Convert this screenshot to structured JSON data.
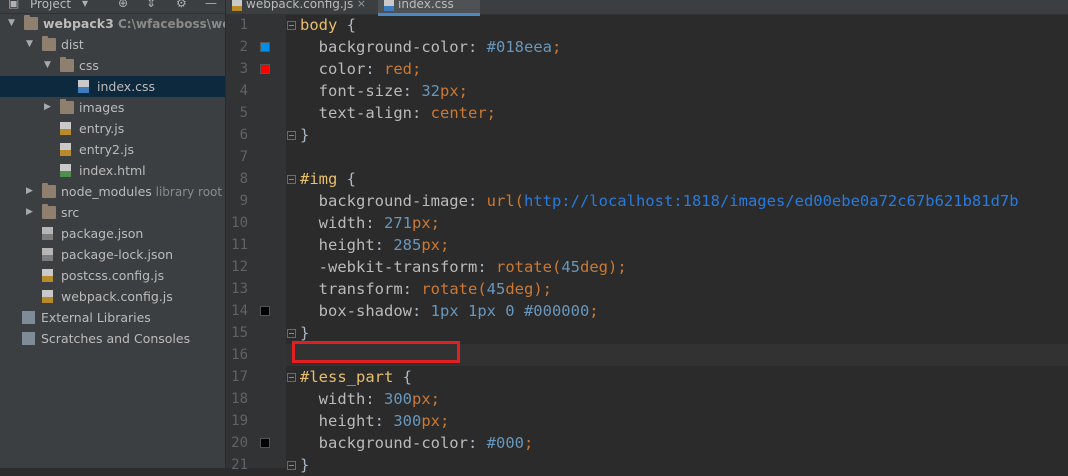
{
  "project": {
    "header_label": "Project",
    "icons": [
      "chevron-down-icon",
      "add-icon",
      "collapse-icon",
      "gear-icon",
      "minimize-icon"
    ],
    "tree": [
      {
        "label": "webpack3",
        "hint": "C:\\wfaceboss\\webpa",
        "icon": "folder-icon",
        "expanded": true,
        "depth": 0
      },
      {
        "label": "dist",
        "icon": "folder-icon",
        "expanded": true,
        "depth": 1
      },
      {
        "label": "css",
        "icon": "folder-icon",
        "expanded": true,
        "depth": 2
      },
      {
        "label": "index.css",
        "icon": "css-file-icon",
        "depth": 3,
        "selected": true
      },
      {
        "label": "images",
        "icon": "folder-icon",
        "expanded": false,
        "depth": 2
      },
      {
        "label": "entry.js",
        "icon": "js-file-icon",
        "depth": 2
      },
      {
        "label": "entry2.js",
        "icon": "js-file-icon",
        "depth": 2
      },
      {
        "label": "index.html",
        "icon": "html-file-icon",
        "depth": 2
      },
      {
        "label": "node_modules",
        "hint": "library root",
        "icon": "folder-icon",
        "expanded": false,
        "depth": 1
      },
      {
        "label": "src",
        "icon": "folder-icon",
        "expanded": false,
        "depth": 1
      },
      {
        "label": "package.json",
        "icon": "json-file-icon",
        "depth": 1
      },
      {
        "label": "package-lock.json",
        "icon": "json-file-icon",
        "depth": 1
      },
      {
        "label": "postcss.config.js",
        "icon": "js-file-icon",
        "depth": 1
      },
      {
        "label": "webpack.config.js",
        "icon": "js-file-icon",
        "depth": 1
      },
      {
        "label": "External Libraries",
        "icon": "library-icon",
        "depth": 0
      },
      {
        "label": "Scratches and Consoles",
        "icon": "scratches-icon",
        "depth": 0
      }
    ]
  },
  "editor": {
    "tabs": [
      {
        "label": "webpack.config.js",
        "icon": "js-file-icon",
        "active": false
      },
      {
        "label": "index.css",
        "icon": "css-file-icon",
        "active": true
      }
    ],
    "line_numbers": [
      "1",
      "2",
      "3",
      "4",
      "5",
      "6",
      "7",
      "8",
      "9",
      "10",
      "11",
      "12",
      "13",
      "14",
      "15",
      "16",
      "17",
      "18",
      "19",
      "20",
      "21"
    ],
    "lines": [
      [
        {
          "t": "body",
          "c": "sel"
        },
        {
          "t": " {",
          "c": "plain"
        }
      ],
      [
        {
          "t": "  background-color",
          "c": "prop"
        },
        {
          "t": ": ",
          "c": "plain"
        },
        {
          "t": "#018eea",
          "c": "num"
        },
        {
          "t": ";",
          "c": "kw"
        }
      ],
      [
        {
          "t": "  color",
          "c": "prop"
        },
        {
          "t": ": ",
          "c": "plain"
        },
        {
          "t": "red",
          "c": "kw"
        },
        {
          "t": ";",
          "c": "kw"
        }
      ],
      [
        {
          "t": "  font-size",
          "c": "prop"
        },
        {
          "t": ": ",
          "c": "plain"
        },
        {
          "t": "32",
          "c": "num"
        },
        {
          "t": "px",
          "c": "kw"
        },
        {
          "t": ";",
          "c": "kw"
        }
      ],
      [
        {
          "t": "  text-align",
          "c": "prop"
        },
        {
          "t": ": ",
          "c": "plain"
        },
        {
          "t": "center",
          "c": "kw"
        },
        {
          "t": ";",
          "c": "kw"
        }
      ],
      [
        {
          "t": "}",
          "c": "plain"
        }
      ],
      [],
      [
        {
          "t": "#img",
          "c": "sel"
        },
        {
          "t": " {",
          "c": "plain"
        }
      ],
      [
        {
          "t": "  background-image",
          "c": "prop"
        },
        {
          "t": ": ",
          "c": "plain"
        },
        {
          "t": "url(",
          "c": "kw"
        },
        {
          "t": "http://localhost:1818/images/ed00ebe0a72c67b621b81d7b",
          "c": "url"
        }
      ],
      [
        {
          "t": "  width",
          "c": "prop"
        },
        {
          "t": ": ",
          "c": "plain"
        },
        {
          "t": "271",
          "c": "num"
        },
        {
          "t": "px",
          "c": "kw"
        },
        {
          "t": ";",
          "c": "kw"
        }
      ],
      [
        {
          "t": "  height",
          "c": "prop"
        },
        {
          "t": ": ",
          "c": "plain"
        },
        {
          "t": "285",
          "c": "num"
        },
        {
          "t": "px",
          "c": "kw"
        },
        {
          "t": ";",
          "c": "kw"
        }
      ],
      [
        {
          "t": "  -webkit-transform",
          "c": "prop"
        },
        {
          "t": ": ",
          "c": "plain"
        },
        {
          "t": "rotate(",
          "c": "kw"
        },
        {
          "t": "45",
          "c": "num"
        },
        {
          "t": "deg",
          "c": "kw"
        },
        {
          "t": ");",
          "c": "kw"
        }
      ],
      [
        {
          "t": "  transform",
          "c": "prop"
        },
        {
          "t": ": ",
          "c": "plain"
        },
        {
          "t": "rotate(",
          "c": "kw"
        },
        {
          "t": "45",
          "c": "num"
        },
        {
          "t": "deg",
          "c": "kw"
        },
        {
          "t": ");",
          "c": "kw"
        }
      ],
      [
        {
          "t": "  box-shadow",
          "c": "prop"
        },
        {
          "t": ": ",
          "c": "plain"
        },
        {
          "t": "1px 1px 0 #000000",
          "c": "num"
        },
        {
          "t": ";",
          "c": "kw"
        }
      ],
      [
        {
          "t": "}",
          "c": "plain"
        }
      ],
      [],
      [
        {
          "t": "#less_part",
          "c": "sel"
        },
        {
          "t": " {",
          "c": "plain"
        }
      ],
      [
        {
          "t": "  width",
          "c": "prop"
        },
        {
          "t": ": ",
          "c": "plain"
        },
        {
          "t": "300",
          "c": "num"
        },
        {
          "t": "px",
          "c": "kw"
        },
        {
          "t": ";",
          "c": "kw"
        }
      ],
      [
        {
          "t": "  height",
          "c": "prop"
        },
        {
          "t": ": ",
          "c": "plain"
        },
        {
          "t": "300",
          "c": "num"
        },
        {
          "t": "px",
          "c": "kw"
        },
        {
          "t": ";",
          "c": "kw"
        }
      ],
      [
        {
          "t": "  background-color",
          "c": "prop"
        },
        {
          "t": ": ",
          "c": "plain"
        },
        {
          "t": "#000",
          "c": "num"
        },
        {
          "t": ";",
          "c": "kw"
        }
      ],
      [
        {
          "t": "}",
          "c": "plain"
        }
      ]
    ],
    "color_swatches": [
      {
        "line": 2,
        "color": "#018eea"
      },
      {
        "line": 3,
        "color": "#ff0000"
      },
      {
        "line": 14,
        "color": "#000000"
      },
      {
        "line": 20,
        "color": "#000000"
      }
    ],
    "fold_markers": [
      1,
      6,
      8,
      15,
      17,
      21
    ],
    "current_line": 16
  },
  "colors": {
    "selection": "#0d293e",
    "tab_accent": "#4a88c7",
    "highlight_box": "#e02020"
  }
}
